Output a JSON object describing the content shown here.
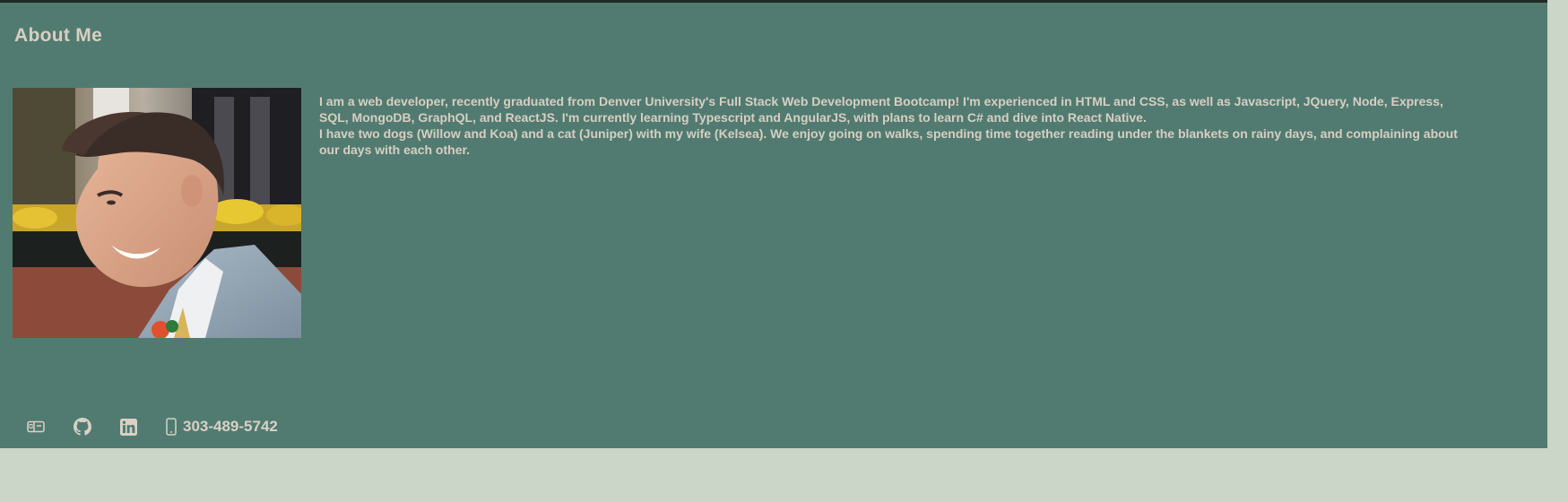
{
  "about": {
    "title": "About Me",
    "photo": {
      "alt": "Profile photo",
      "icon": "profile-photo"
    },
    "bio": {
      "paragraph1": "I am a web developer, recently graduated from Denver University's Full Stack Web Development Bootcamp! I'm experienced in HTML and CSS, as well as Javascript, JQuery, Node, Express, SQL, MongoDB, GraphQL, and ReactJS. I'm currently learning Typescript and AngularJS, with plans to learn C# and dive into React Native.",
      "paragraph2": "I have two dogs (Willow and Koa) and a cat (Juniper) with my wife (Kelsea). We enjoy going on walks, spending time together reading under the blankets on rainy days, and complaining about our days with each other."
    }
  },
  "footer": {
    "links": [
      {
        "icon": "mailbox-icon"
      },
      {
        "icon": "github-icon"
      },
      {
        "icon": "linkedin-icon"
      },
      {
        "icon": "phone-icon"
      }
    ],
    "phone": "303-489-5742"
  },
  "colors": {
    "page_background": "#cbd5c8",
    "section_background": "#517b70",
    "text": "#d6cfc3",
    "top_border": "#1f2a26"
  }
}
